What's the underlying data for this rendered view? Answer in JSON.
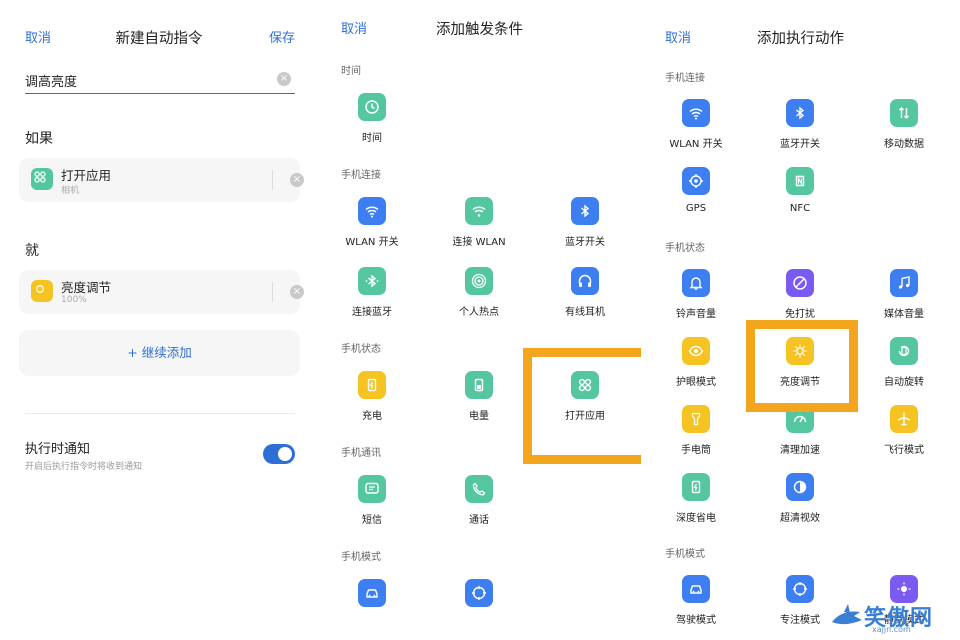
{
  "panel1": {
    "cancel": "取消",
    "title": "新建自动指令",
    "save": "保存",
    "name_value": "调高亮度",
    "if_title": "如果",
    "if_card": {
      "title": "打开应用",
      "sub": "相机"
    },
    "then_title": "就",
    "then_card": {
      "title": "亮度调节",
      "sub": "100%"
    },
    "add_more": "+ 继续添加",
    "notify_title": "执行时通知",
    "notify_desc": "开启后执行指令时将收到通知"
  },
  "panel2": {
    "cancel": "取消",
    "title": "添加触发条件",
    "groups": [
      {
        "title": "时间",
        "items": [
          {
            "label": "时间",
            "color": "green",
            "icon": "clock-icon"
          }
        ]
      },
      {
        "title": "手机连接",
        "items": [
          {
            "label": "WLAN 开关",
            "color": "blue",
            "icon": "wifi-icon"
          },
          {
            "label": "连接 WLAN",
            "color": "green",
            "icon": "wifi-connect-icon"
          },
          {
            "label": "蓝牙开关",
            "color": "blue",
            "icon": "bluetooth-icon"
          },
          {
            "label": "连接蓝牙",
            "color": "green",
            "icon": "bluetooth-connect-icon"
          },
          {
            "label": "个人热点",
            "color": "green",
            "icon": "hotspot-icon"
          },
          {
            "label": "有线耳机",
            "color": "blue",
            "icon": "headphone-icon"
          }
        ]
      },
      {
        "title": "手机状态",
        "items": [
          {
            "label": "充电",
            "color": "yellow",
            "icon": "charging-icon"
          },
          {
            "label": "电量",
            "color": "green",
            "icon": "battery-icon"
          },
          {
            "label": "打开应用",
            "color": "green",
            "icon": "app-grid-icon"
          }
        ]
      },
      {
        "title": "手机通讯",
        "items": [
          {
            "label": "短信",
            "color": "green",
            "icon": "sms-icon"
          },
          {
            "label": "通话",
            "color": "green",
            "icon": "phone-icon"
          }
        ]
      },
      {
        "title": "手机模式",
        "items": [
          {
            "label": "",
            "color": "blue",
            "icon": "car-icon"
          },
          {
            "label": "",
            "color": "blue",
            "icon": "focus-icon"
          }
        ]
      }
    ]
  },
  "panel3": {
    "cancel": "取消",
    "title": "添加执行动作",
    "groups": [
      {
        "title": "手机连接",
        "items": [
          {
            "label": "WLAN 开关",
            "color": "blue",
            "icon": "wifi-icon"
          },
          {
            "label": "蓝牙开关",
            "color": "blue",
            "icon": "bluetooth-icon"
          },
          {
            "label": "移动数据",
            "color": "green",
            "icon": "mobile-data-icon"
          },
          {
            "label": "GPS",
            "color": "blue",
            "icon": "gps-icon"
          },
          {
            "label": "NFC",
            "color": "green",
            "icon": "nfc-icon"
          }
        ]
      },
      {
        "title": "手机状态",
        "items": [
          {
            "label": "铃声音量",
            "color": "blue",
            "icon": "bell-icon"
          },
          {
            "label": "免打扰",
            "color": "purple",
            "icon": "do-not-disturb-icon"
          },
          {
            "label": "媒体音量",
            "color": "blue",
            "icon": "music-icon"
          },
          {
            "label": "护眼模式",
            "color": "yellow",
            "icon": "eye-icon"
          },
          {
            "label": "亮度调节",
            "color": "yellow",
            "icon": "brightness-icon"
          },
          {
            "label": "自动旋转",
            "color": "green",
            "icon": "rotate-icon"
          },
          {
            "label": "手电筒",
            "color": "yellow",
            "icon": "flashlight-icon"
          },
          {
            "label": "清理加速",
            "color": "green",
            "icon": "speed-icon"
          },
          {
            "label": "飞行模式",
            "color": "yellow",
            "icon": "airplane-icon"
          },
          {
            "label": "深度省电",
            "color": "green",
            "icon": "power-save-icon"
          },
          {
            "label": "超清视效",
            "color": "blue",
            "icon": "contrast-icon"
          }
        ]
      },
      {
        "title": "手机模式",
        "items": [
          {
            "label": "驾驶模式",
            "color": "blue",
            "icon": "car-icon"
          },
          {
            "label": "专注模式",
            "color": "blue",
            "icon": "focus-icon"
          },
          {
            "label": "静默模式",
            "color": "purple",
            "icon": "night-icon"
          }
        ]
      }
    ]
  },
  "watermark": {
    "brand": "笑傲网",
    "domain": "xajjn.com"
  }
}
